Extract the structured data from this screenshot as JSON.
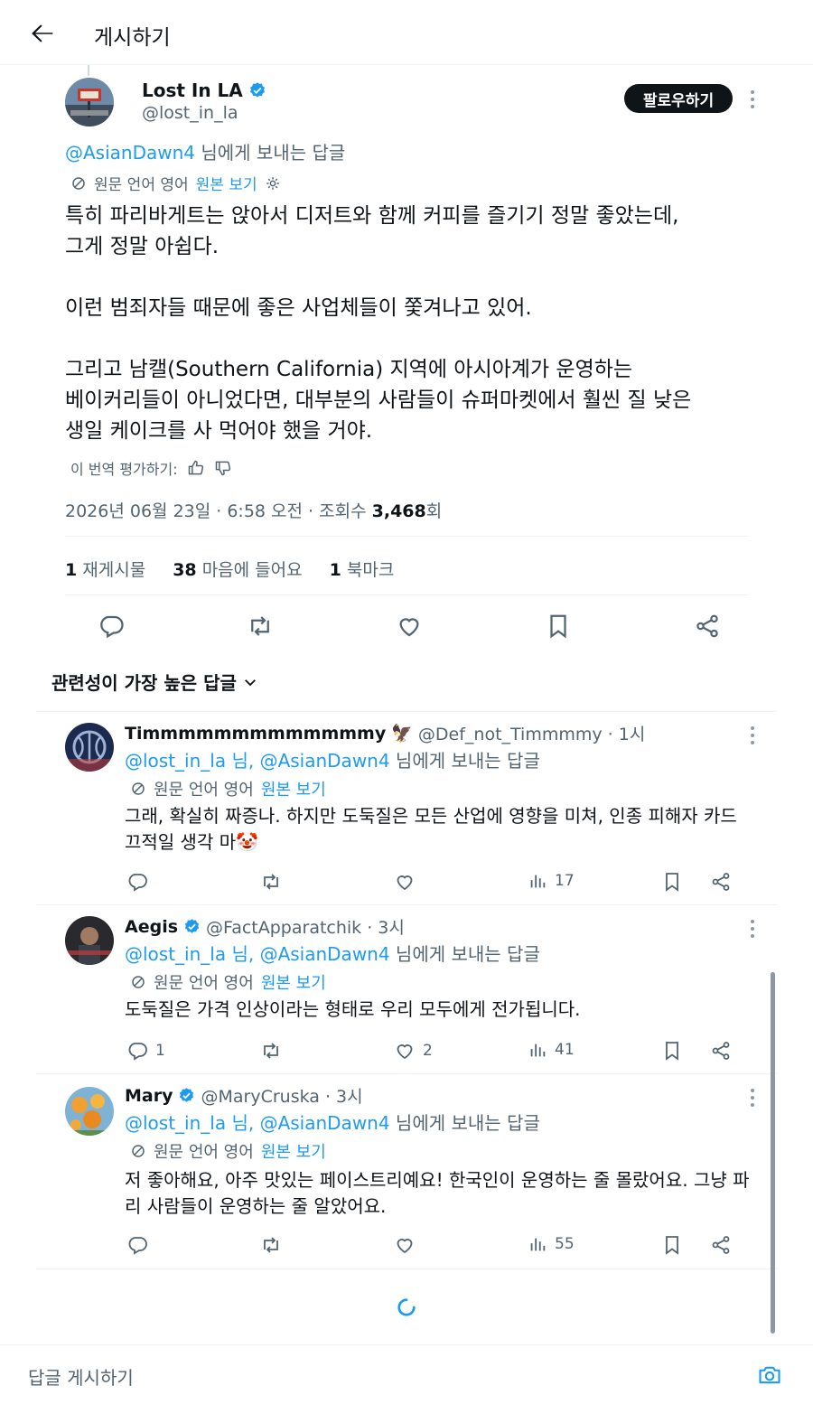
{
  "header": {
    "title": "게시하기"
  },
  "main_tweet": {
    "author_name": "Lost In LA",
    "handle": "@lost_in_la",
    "follow_label": "팔로우하기",
    "reply_to_mention": "@AsianDawn4",
    "reply_to_suffix": " 님에게 보내는 답글",
    "translate_label": "원문 언어 영어",
    "view_original": "원본 보기",
    "body": "특히 파리바게트는 앉아서 디저트와 함께 커피를 즐기기 정말 좋았는데,\n그게 정말 아쉽다.\n\n이런 범죄자들 때문에 좋은 사업체들이 쫓겨나고 있어.\n\n그리고 남캘(Southern California) 지역에 아시아계가 운영하는\n베이커리들이 아니었다면, 대부분의 사람들이 슈퍼마켓에서 훨씬 질 낮은\n생일 케이크를 사 먹어야 했을 거야.",
    "rate_label": "이 번역 평가하기:",
    "timestamp": "2026년 06월 23일 · 6:58 오전 · 조회수 ",
    "views": "3,468",
    "views_suffix": "회",
    "stats": {
      "reposts_count": "1",
      "reposts_label": " 재게시물",
      "likes_count": "38",
      "likes_label": " 마음에 들어요",
      "bookmarks_count": "1",
      "bookmarks_label": " 북마크"
    }
  },
  "sort_label": "관련성이 가장 높은 답글",
  "replies": [
    {
      "name": "Timmmmmmmmmmmmmy",
      "emoji": "🦅",
      "meta": "@Def_not_Timmmmy · 1시",
      "reply_to_mentions": "@lost_in_la 님, @AsianDawn4",
      "reply_to_suffix": " 님에게 보내는 답글",
      "translate_label": "원문 언어 영어",
      "view_original": "원본 보기",
      "body": "그래, 확실히 짜증나. 하지만 도둑질은 모든 산업에 영향을 미쳐, 인종 피해자 카드 끄적일 생각 마",
      "body_emoji": "🤡",
      "replies": "",
      "reposts": "",
      "likes": "",
      "views": "17"
    },
    {
      "name": "Aegis",
      "meta": "@FactApparatchik · 3시",
      "reply_to_mentions": "@lost_in_la 님, @AsianDawn4",
      "reply_to_suffix": " 님에게 보내는 답글",
      "translate_label": "원문 언어 영어",
      "view_original": "원본 보기",
      "body": "도둑질은 가격 인상이라는 형태로 우리 모두에게 전가됩니다.",
      "replies": "1",
      "reposts": "",
      "likes": "2",
      "views": "41"
    },
    {
      "name": "Mary",
      "meta": "@MaryCruska · 3시",
      "reply_to_mentions": "@lost_in_la 님, @AsianDawn4",
      "reply_to_suffix": " 님에게 보내는 답글",
      "translate_label": "원문 언어 영어",
      "view_original": "원본 보기",
      "body": "저 좋아해요, 아주 맛있는 페이스트리예요! 한국인이 운영하는 줄 몰랐어요. 그냥 파리 사람들이 운영하는 줄 알았어요.",
      "replies": "",
      "reposts": "",
      "likes": "",
      "views": "55"
    }
  ],
  "composer": {
    "placeholder": "답글 게시하기"
  },
  "colors": {
    "accent": "#1d9bf0",
    "text": "#0f1419",
    "muted": "#536471",
    "border": "#eff3f4"
  },
  "icons": [
    "back-arrow-icon",
    "verified-badge-icon",
    "more-icon",
    "translate-icon",
    "gear-icon",
    "thumbs-up-icon",
    "thumbs-down-icon",
    "reply-icon",
    "repost-icon",
    "like-icon",
    "bookmark-icon",
    "share-icon",
    "views-icon",
    "chevron-down-icon",
    "loading-spinner-icon",
    "camera-icon"
  ]
}
